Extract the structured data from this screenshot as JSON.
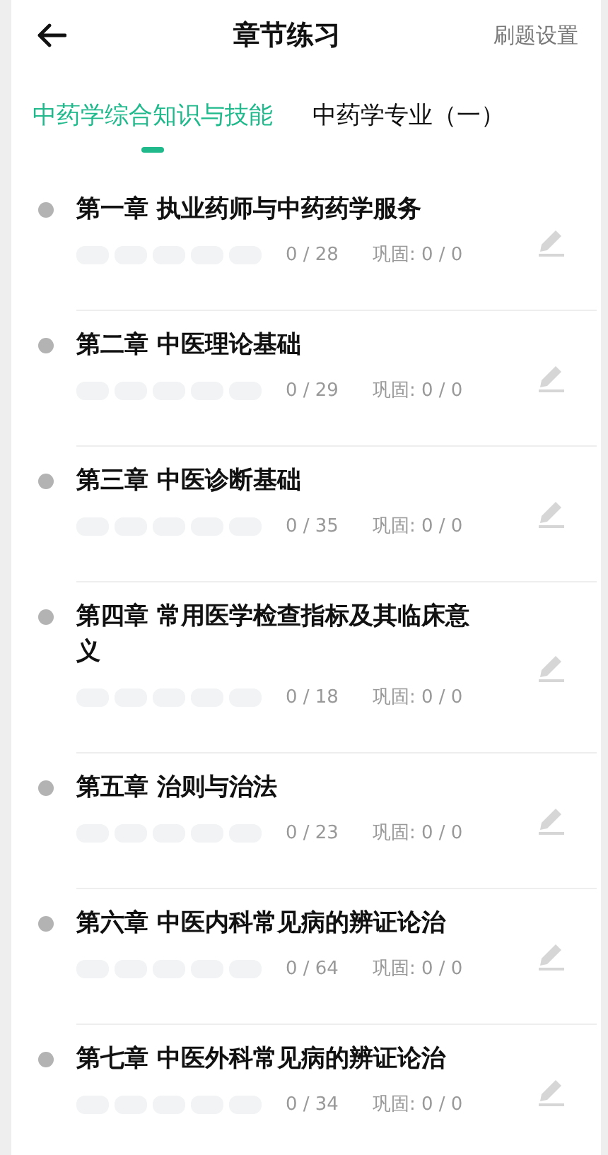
{
  "header": {
    "title": "章节练习",
    "action": "刷题设置"
  },
  "tabs": [
    {
      "label": "中药学综合知识与技能",
      "selected": true
    },
    {
      "label": "中药学专业（一）",
      "selected": false
    }
  ],
  "chapters": [
    {
      "title": "第一章 执业药师与中药药学服务",
      "progress": "0 / 28",
      "review": "巩固: 0 / 0"
    },
    {
      "title": "第二章 中医理论基础",
      "progress": "0 / 29",
      "review": "巩固: 0 / 0"
    },
    {
      "title": "第三章 中医诊断基础",
      "progress": "0 / 35",
      "review": "巩固: 0 / 0"
    },
    {
      "title": "第四章 常用医学检查指标及其临床意义",
      "progress": "0 / 18",
      "review": "巩固: 0 / 0"
    },
    {
      "title": "第五章 治则与治法",
      "progress": "0 / 23",
      "review": "巩固: 0 / 0"
    },
    {
      "title": "第六章 中医内科常见病的辨证论治",
      "progress": "0 / 64",
      "review": "巩固: 0 / 0"
    },
    {
      "title": "第七章 中医外科常见病的辨证论治",
      "progress": "0 / 34",
      "review": "巩固: 0 / 0"
    }
  ]
}
